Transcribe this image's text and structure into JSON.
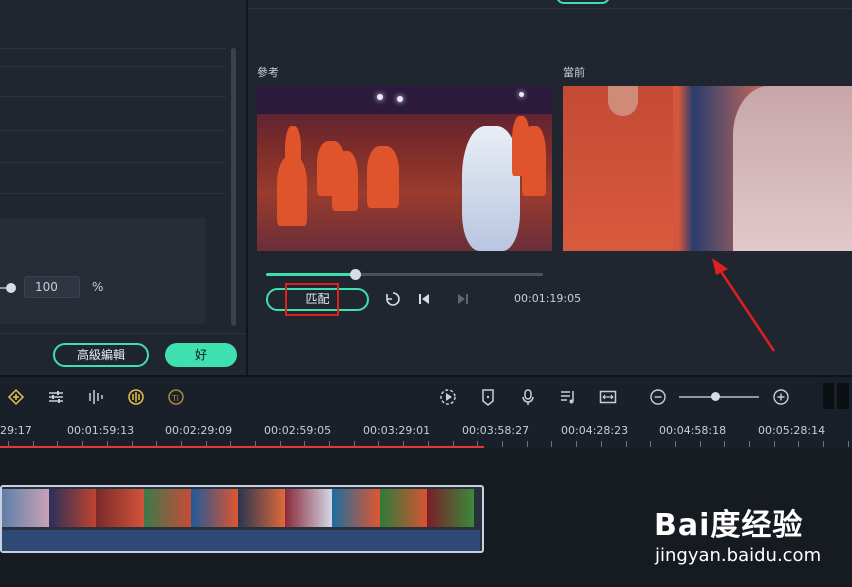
{
  "left_panel": {
    "slider_value": "100",
    "unit": "%",
    "advanced_edit_label": "高級編輯",
    "ok_label": "好"
  },
  "right_panel": {
    "reference_label": "參考",
    "current_label": "當前",
    "match_label": "匹配",
    "timecode": "00:01:19:05",
    "progress": 0.32
  },
  "timeline": {
    "ruler_labels": [
      "29:17",
      "00:01:59:13",
      "00:02:29:09",
      "00:02:59:05",
      "00:03:29:01",
      "00:03:58:27",
      "00:04:28:23",
      "00:04:58:18",
      "00:05:28:14"
    ],
    "zoom_level": 0.45
  },
  "toolbar_icons": [
    "keyframe-icon",
    "adjust-icon",
    "audio-mixer-icon",
    "color-match-icon",
    "speech-icon",
    "render-icon",
    "marker-icon",
    "microphone-icon",
    "voiceover-icon",
    "fit-icon",
    "zoom-out-icon",
    "zoom-in-icon"
  ],
  "watermark": {
    "logo": "Bai度经验",
    "sub": "jingyan.baidu.com"
  },
  "colors": {
    "accent": "#3ee0b0",
    "highlight": "#e01f1f",
    "background": "#20262f"
  }
}
